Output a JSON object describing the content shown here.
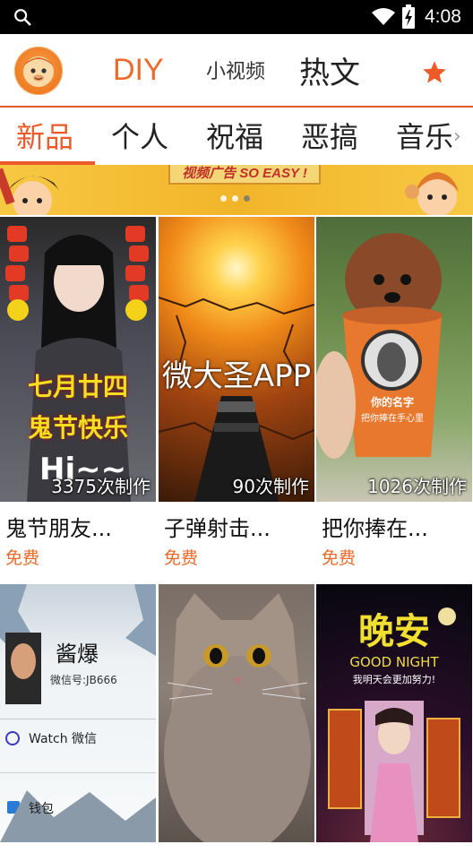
{
  "status_bar": {
    "time": "4:08"
  },
  "top_nav": {
    "items": [
      {
        "label": "DIY",
        "active": true
      },
      {
        "label": "小视频",
        "active": false
      },
      {
        "label": "热文",
        "active": false
      }
    ],
    "favorite_icon": "star-icon",
    "accent_color": "#ea5a2a"
  },
  "categories": {
    "items": [
      {
        "label": "新品",
        "active": true
      },
      {
        "label": "个人",
        "active": false
      },
      {
        "label": "祝福",
        "active": false
      },
      {
        "label": "恶搞",
        "active": false
      },
      {
        "label": "音乐",
        "active": false
      }
    ],
    "more_icon": "chevron-right-icon"
  },
  "banner": {
    "text": "视频广告 SO EASY !",
    "page_count": 3,
    "current_page": 3
  },
  "cards": [
    {
      "title": "鬼节朋友...",
      "price": "免费",
      "count": "3375次制作",
      "overlay_lines": [
        "七月廿四",
        "鬼节快乐",
        "Hi~~"
      ]
    },
    {
      "title": "子弹射击...",
      "price": "免费",
      "count": "90次制作",
      "overlay_lines": [
        "微大圣APP"
      ]
    },
    {
      "title": "把你捧在...",
      "price": "免费",
      "count": "1026次制作",
      "overlay_lines": [
        "你的名字",
        "把你捧在手心里"
      ]
    },
    {
      "title": "",
      "price": "",
      "count": "",
      "overlay_lines": [
        "酱爆",
        "微信号:JB666",
        "Watch 微信",
        "钱包"
      ]
    },
    {
      "title": "",
      "price": "",
      "count": "",
      "overlay_lines": []
    },
    {
      "title": "",
      "price": "",
      "count": "",
      "overlay_lines": [
        "晚安",
        "GOOD NIGHT",
        "我明天会更加努力!"
      ]
    }
  ]
}
